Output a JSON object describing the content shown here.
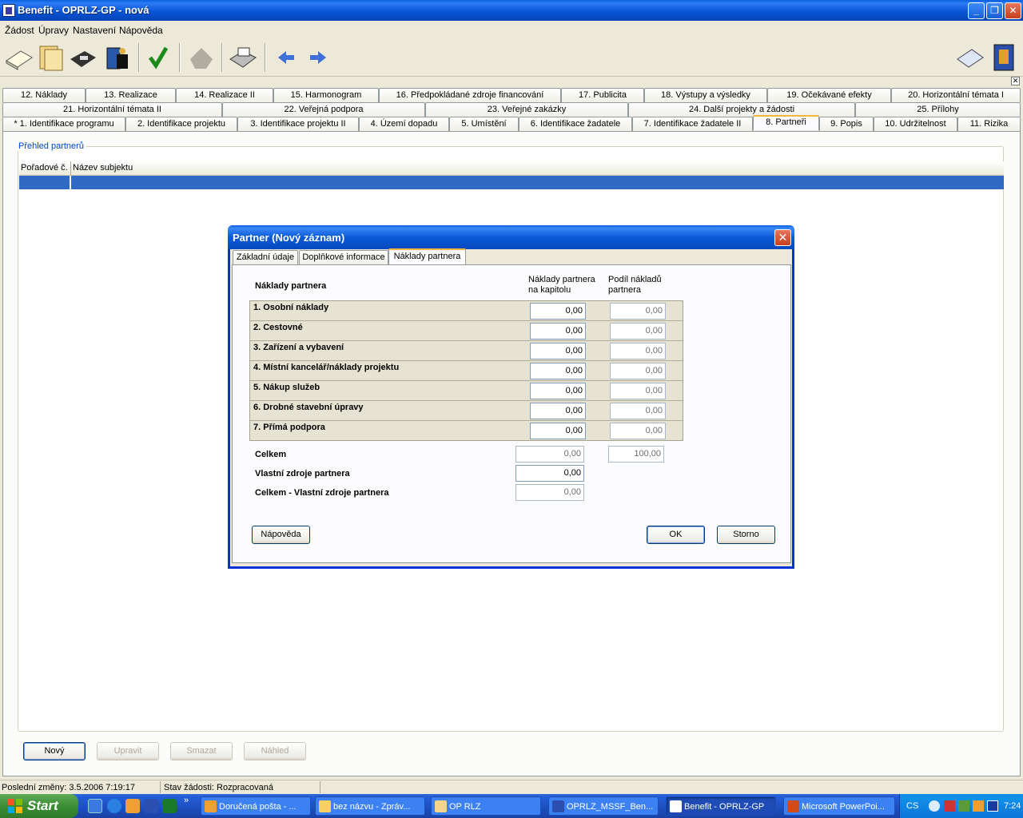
{
  "window": {
    "title": "Benefit - OPRLZ-GP - nová",
    "controls": {
      "minimize": "_",
      "restore": "❐",
      "close": "✕"
    }
  },
  "menu": [
    "Žádost",
    "Úpravy",
    "Nastavení",
    "Nápověda"
  ],
  "toolbar": {
    "tools": [
      "new-document-icon",
      "open-folder-icon",
      "save-disk-icon",
      "database-icon",
      "check-icon",
      "disabled-icon",
      "print-icon",
      "arrow-left-icon",
      "arrow-right-icon",
      "book-icon",
      "help-book-icon"
    ]
  },
  "tabs": {
    "row1": [
      "12. Náklady",
      "13. Realizace",
      "14. Realizace II",
      "15. Harmonogram",
      "16. Předpokládané zdroje financování",
      "17. Publicita",
      "18. Výstupy a výsledky",
      "19. Očekávané efekty",
      "20. Horizontální témata I"
    ],
    "row2": [
      "21. Horizontální témata II",
      "22. Veřejná podpora",
      "23. Veřejné zakázky",
      "24. Další projekty a žádosti",
      "25. Přílohy"
    ],
    "row3": [
      "* 1. Identifikace programu",
      "2. Identifikace projektu",
      "3. Identifikace projektu II",
      "4. Území dopadu",
      "5. Umístění",
      "6. Identifikace žadatele",
      "7. Identifikace žadatele II",
      "8. Partneři",
      "9. Popis",
      "10. Udržitelnost",
      "11. Rizika"
    ],
    "close": "✕"
  },
  "main": {
    "group_label": "Přehled partnerů",
    "columns": [
      "Pořadové č.",
      "Název subjektu"
    ],
    "buttons": {
      "new": "Nový",
      "edit": "Upravit",
      "delete": "Smazat",
      "preview": "Náhled"
    }
  },
  "status": {
    "last_change": "Poslední změny: 3.5.2006 7:19:17",
    "state": "Stav žádosti: Rozpracovaná"
  },
  "dialog": {
    "title": "Partner (Nový záznam)",
    "close": "✕",
    "tabs": [
      "Základní údaje",
      "Doplňkové informace",
      "Náklady partnera"
    ],
    "section_label": "Náklady partnera",
    "col1_header": "Náklady partnera na kapitolu",
    "col2_header": "Podíl nákladů partnera",
    "rows": [
      {
        "name": "1. Osobní náklady",
        "cost": "0,00",
        "share": "0,00"
      },
      {
        "name": "2. Cestovné",
        "cost": "0,00",
        "share": "0,00"
      },
      {
        "name": "3. Zařízení a vybavení",
        "cost": "0,00",
        "share": "0,00"
      },
      {
        "name": "4. Místní kancelář/náklady projektu",
        "cost": "0,00",
        "share": "0,00"
      },
      {
        "name": "5. Nákup služeb",
        "cost": "0,00",
        "share": "0,00"
      },
      {
        "name": "6. Drobné stavební úpravy",
        "cost": "0,00",
        "share": "0,00"
      },
      {
        "name": "7. Přímá podpora",
        "cost": "0,00",
        "share": "0,00"
      }
    ],
    "total_label": "Celkem",
    "total_cost": "0,00",
    "total_share": "100,00",
    "own_label": "Vlastní zdroje partnera",
    "own_value": "0,00",
    "diff_label": "Celkem - Vlastní zdroje partnera",
    "diff_value": "0,00",
    "buttons": {
      "help": "Nápověda",
      "ok": "OK",
      "cancel": "Storno"
    }
  },
  "taskbar": {
    "start": "Start",
    "overflow": "»",
    "tasks": [
      "Doručená pošta - ...",
      "bez názvu - Zpráv...",
      "OP RLZ",
      "OPRLZ_MSSF_Ben...",
      "Benefit - OPRLZ-GP",
      "Microsoft PowerPoi..."
    ],
    "lang": "CS",
    "clock": "7:24"
  }
}
